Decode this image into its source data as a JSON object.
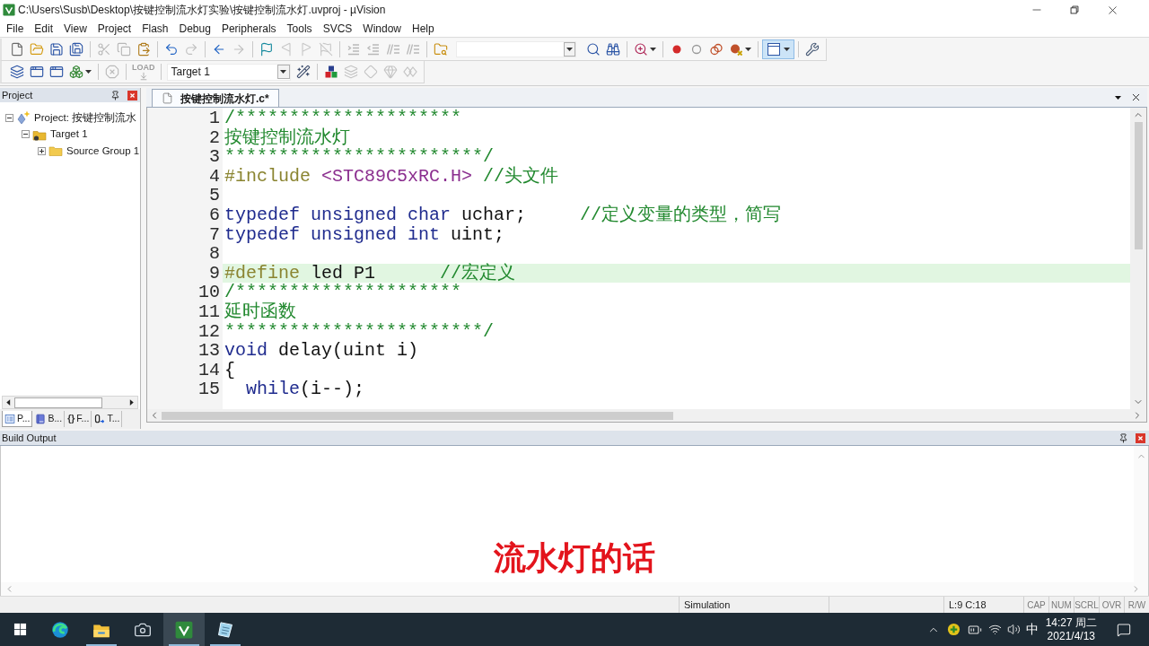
{
  "window": {
    "title": "C:\\Users\\Susb\\Desktop\\按键控制流水灯实验\\按键控制流水灯.uvproj - µVision"
  },
  "menu_bar": [
    "File",
    "Edit",
    "View",
    "Project",
    "Flash",
    "Debug",
    "Peripherals",
    "Tools",
    "SVCS",
    "Window",
    "Help"
  ],
  "toolbar_1": {
    "left": [
      [
        {
          "disabled": false
        },
        {
          "disabled": false
        },
        {
          "disabled": false
        },
        {
          "disabled": false
        }
      ],
      [
        {
          "disabled": true
        },
        {
          "disabled": true
        },
        {
          "disabled": false
        }
      ],
      [
        {
          "disabled": false
        },
        {
          "disabled": true
        }
      ],
      [
        {
          "disabled": false
        },
        {
          "disabled": true
        }
      ],
      [
        {
          "disabled": false
        },
        {
          "disabled": true
        },
        {
          "disabled": true
        },
        {
          "disabled": true
        }
      ],
      [
        {
          "disabled": true
        },
        {
          "disabled": true
        },
        {
          "disabled": true
        },
        {
          "disabled": true
        }
      ],
      [
        {
          "disabled": false
        }
      ]
    ],
    "right": [
      [
        {
          "disabled": false
        },
        {
          "disabled": false
        }
      ],
      [
        {
          "disabled": false
        }
      ],
      [
        {
          "disabled": false
        },
        {
          "disabled": false
        },
        {
          "disabled": false
        },
        {
          "disabled": false
        }
      ]
    ],
    "layout_button": {
      "pressed": true
    },
    "right_end": [
      {
        "disabled": false
      }
    ]
  },
  "toolbar_2": {
    "left": [
      [
        {
          "disabled": false
        },
        {
          "disabled": false
        },
        {
          "disabled": false
        },
        {
          "disabled": false
        }
      ],
      [
        {
          "disabled": true
        }
      ]
    ],
    "load": {
      "label": "LOAD",
      "disabled": true
    },
    "target_select": {
      "value": "Target 1"
    },
    "options": [
      {
        "disabled": false
      }
    ],
    "right": [
      [
        {
          "disabled": false
        },
        {
          "disabled": true
        },
        {
          "disabled": true
        },
        {
          "disabled": true
        },
        {
          "disabled": true
        }
      ]
    ]
  },
  "project_panel": {
    "title": "Project",
    "tree": [
      {
        "label": "Project: 按键控制流水",
        "expanded": true,
        "children": [
          {
            "label": "Target 1",
            "expanded": true,
            "children": [
              {
                "label": "Source Group 1",
                "expanded": false
              }
            ]
          }
        ]
      }
    ],
    "tabs": [
      {
        "label": "P...",
        "selected": true
      },
      {
        "label": "B...",
        "selected": false
      },
      {
        "glyph": "{}",
        "label": "F...",
        "selected": false
      },
      {
        "label": "T...",
        "selected": false
      }
    ]
  },
  "editor": {
    "tabs": [
      {
        "label": "按键控制流水灯.c*",
        "selected": true
      }
    ],
    "lines": [
      {
        "number": "1",
        "highlighted": false,
        "tokens": [
          {
            "kind": "comment",
            "text": "/*********************"
          }
        ]
      },
      {
        "number": "2",
        "highlighted": false,
        "tokens": [
          {
            "kind": "comment",
            "text": "按键控制流水灯"
          }
        ]
      },
      {
        "number": "3",
        "highlighted": false,
        "tokens": [
          {
            "kind": "comment",
            "text": "************************/"
          }
        ]
      },
      {
        "number": "4",
        "highlighted": false,
        "tokens": [
          {
            "kind": "preprocessor",
            "text": "#include "
          },
          {
            "kind": "header",
            "text": "<STC89C5xRC.H>"
          },
          {
            "kind": "comment",
            "text": " //头文件"
          }
        ]
      },
      {
        "number": "5",
        "highlighted": false
      },
      {
        "number": "6",
        "highlighted": false,
        "tokens": [
          {
            "kind": "keyword",
            "text": "typedef unsigned char"
          },
          {
            "kind": "plain",
            "text": " uchar;     "
          },
          {
            "kind": "comment",
            "text": "//定义变量的类型，简写"
          }
        ]
      },
      {
        "number": "7",
        "highlighted": false,
        "tokens": [
          {
            "kind": "keyword",
            "text": "typedef unsigned int"
          },
          {
            "kind": "plain",
            "text": " uint;"
          }
        ]
      },
      {
        "number": "8",
        "highlighted": false
      },
      {
        "number": "9",
        "highlighted": true,
        "tokens": [
          {
            "kind": "preprocessor",
            "text": "#define"
          },
          {
            "kind": "plain",
            "text": " led P1      "
          },
          {
            "kind": "comment",
            "text": "//宏定义"
          }
        ]
      },
      {
        "number": "10",
        "highlighted": false,
        "tokens": [
          {
            "kind": "comment",
            "text": "/*********************"
          }
        ]
      },
      {
        "number": "11",
        "highlighted": false,
        "tokens": [
          {
            "kind": "comment",
            "text": "延时函数"
          }
        ]
      },
      {
        "number": "12",
        "highlighted": false,
        "tokens": [
          {
            "kind": "comment",
            "text": "************************/"
          }
        ]
      },
      {
        "number": "13",
        "highlighted": false,
        "tokens": [
          {
            "kind": "keyword",
            "text": "void"
          },
          {
            "kind": "plain",
            "text": " delay(uint i)"
          }
        ]
      },
      {
        "number": "14",
        "highlighted": false,
        "tokens": [
          {
            "kind": "plain",
            "text": "{"
          }
        ]
      },
      {
        "number": "15",
        "highlighted": false,
        "tokens": [
          {
            "kind": "keyword",
            "text": "  while"
          },
          {
            "kind": "plain",
            "text": "(i--);"
          }
        ]
      }
    ]
  },
  "build_output": {
    "title": "Build Output"
  },
  "caption": {
    "text": "流水灯的话"
  },
  "status_bar": {
    "mode": "Simulation",
    "position": "L:9 C:18",
    "indicators": [
      "CAP",
      "NUM",
      "SCRL",
      "OVR",
      "R/W"
    ]
  },
  "taskbar": {
    "apps": [
      {
        "running": false,
        "active": false
      },
      {
        "running": true,
        "active": false
      },
      {
        "running": false,
        "active": false
      },
      {
        "running": true,
        "active": true
      },
      {
        "running": true,
        "active": false
      }
    ],
    "tray": {
      "ime": "中",
      "time": "14:27 周二",
      "date": "2021/4/13"
    }
  }
}
